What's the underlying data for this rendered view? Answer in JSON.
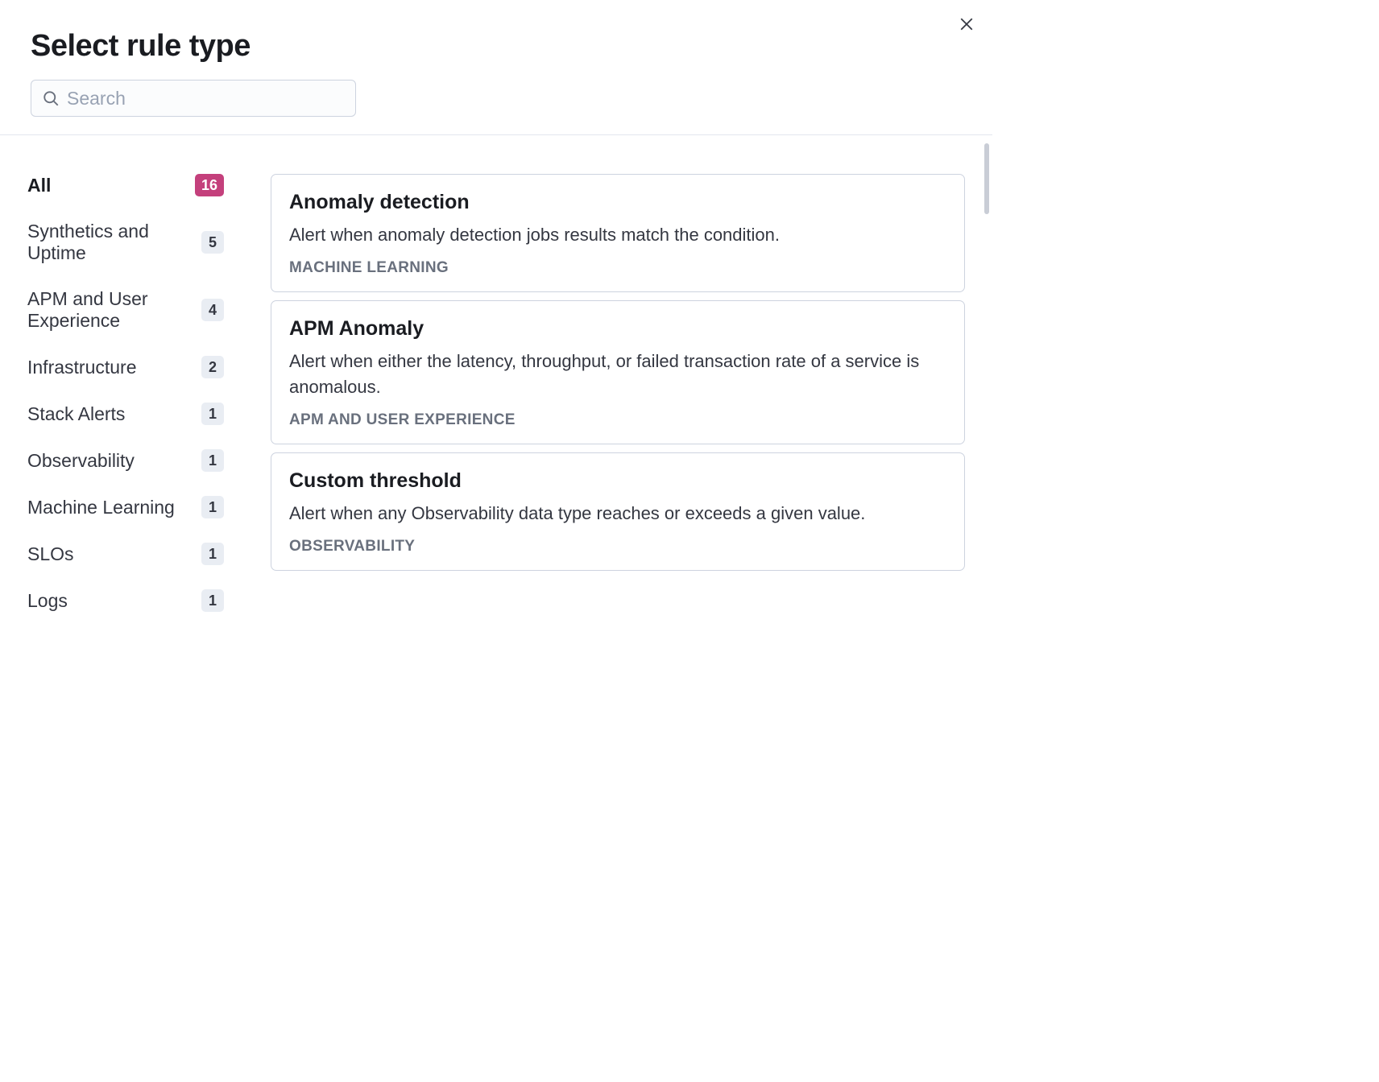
{
  "modal": {
    "title": "Select rule type",
    "search_placeholder": "Search"
  },
  "sidebar": {
    "items": [
      {
        "label": "All",
        "count": "16",
        "active": true
      },
      {
        "label": "Synthetics and Uptime",
        "count": "5",
        "active": false
      },
      {
        "label": "APM and User Experience",
        "count": "4",
        "active": false
      },
      {
        "label": "Infrastructure",
        "count": "2",
        "active": false
      },
      {
        "label": "Stack Alerts",
        "count": "1",
        "active": false
      },
      {
        "label": "Observability",
        "count": "1",
        "active": false
      },
      {
        "label": "Machine Learning",
        "count": "1",
        "active": false
      },
      {
        "label": "SLOs",
        "count": "1",
        "active": false
      },
      {
        "label": "Logs",
        "count": "1",
        "active": false
      }
    ]
  },
  "cards": [
    {
      "title": "Anomaly detection",
      "description": "Alert when anomaly detection jobs results match the condition.",
      "tag": "MACHINE LEARNING"
    },
    {
      "title": "APM Anomaly",
      "description": "Alert when either the latency, throughput, or failed transaction rate of a service is anomalous.",
      "tag": "APM AND USER EXPERIENCE"
    },
    {
      "title": "Custom threshold",
      "description": "Alert when any Observability data type reaches or exceeds a given value.",
      "tag": "OBSERVABILITY"
    }
  ]
}
